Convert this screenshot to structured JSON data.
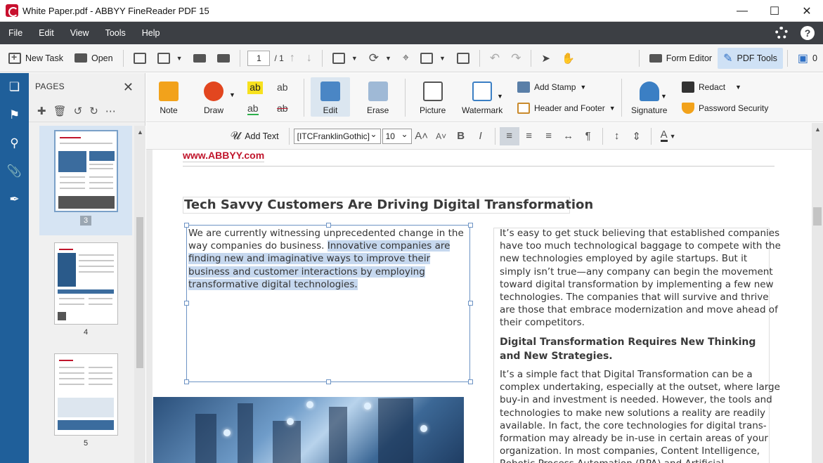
{
  "window": {
    "title": "White Paper.pdf - ABBYY FineReader PDF 15",
    "controls": [
      "minimize",
      "maximize",
      "close"
    ]
  },
  "menu": {
    "items": [
      "File",
      "Edit",
      "View",
      "Tools",
      "Help"
    ]
  },
  "toolbar": {
    "new_task": "New Task",
    "open": "Open",
    "page_current": "1",
    "page_total": "/ 1",
    "form_editor": "Form Editor",
    "pdf_tools": "PDF Tools",
    "comments_count": "0"
  },
  "pages_panel": {
    "title": "PAGES",
    "thumbnails": [
      {
        "num": "3",
        "selected": true
      },
      {
        "num": "4",
        "selected": false
      },
      {
        "num": "5",
        "selected": false
      }
    ]
  },
  "ribbon": {
    "note": "Note",
    "draw": "Draw",
    "edit": "Edit",
    "erase": "Erase",
    "picture": "Picture",
    "watermark": "Watermark",
    "add_stamp": "Add Stamp",
    "header_footer": "Header and Footer",
    "signature": "Signature",
    "redact": "Redact",
    "password_security": "Password Security",
    "text_ab": "ab"
  },
  "format_bar": {
    "add_text": "Add Text",
    "font": "[ITCFranklinGothic]",
    "size": "10"
  },
  "document": {
    "link": "www.ABBYY.com",
    "title": "Tech Savvy Customers Are Driving Digital Transformation",
    "left_plain": "We are currently witnessing unprecedented change in the way companies do business. ",
    "left_highlight": "Innovative companies are finding new and imaginative ways to improve their business and customer interactions by employing transformative digital technologies.",
    "right_para1": "It’s easy to get stuck believing that established companies have too much technological baggage to compete with the new technologies employed by agile startups. But it simply isn’t true—any company can begin the movement toward digital transformation by implementing a few new technologies. The companies that will survive and thrive are those that embrace modernization and move ahead of their competitors.",
    "subheading": "Digital Transformation Requires New Thinking and New Strategies.",
    "right_para2": "It’s a simple fact that Digital Transformation can be a complex undertaking, especially at the outset, where large buy-in and investment is needed. However, the tools and technologies to make new solutions a reality are readily available. In fact, the core technologies for digital trans-formation may already be in-use in certain areas of your organization. In most companies, Content Intelligence, Robotic Process Automation (RPA) and Artificial Intelligence"
  },
  "colors": {
    "menubar": "#3c3f44",
    "nav": "#1f5f9a",
    "accent_red": "#c0152b",
    "highlight": "#c6d8ef"
  }
}
